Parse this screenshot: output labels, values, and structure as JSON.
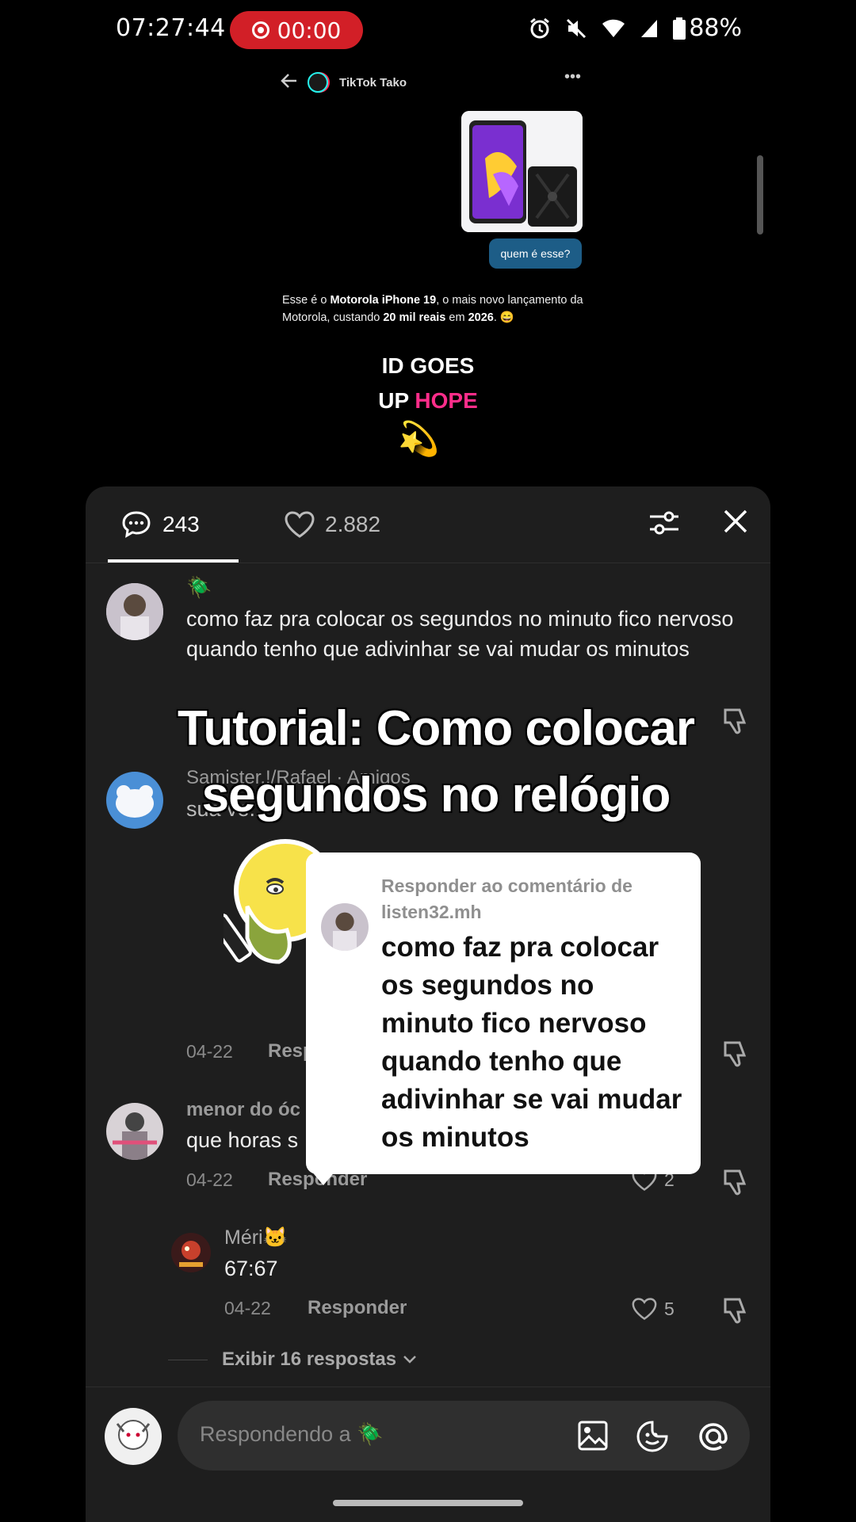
{
  "status_bar": {
    "time": "07:27:44",
    "recording_time": "00:00",
    "battery": "88%"
  },
  "chat": {
    "app_name": "TikTok Tako",
    "sent_message": "quem é esse?",
    "bot_reply_parts": [
      "Esse é o ",
      "Motorola iPhone 19",
      ", o mais novo lançamento da Motorola, custando ",
      "20 mil reais",
      " em ",
      "2026",
      ". 😄"
    ],
    "caption_line1": "ID GOES",
    "caption_line2_a": "UP ",
    "caption_line2_b": "HOPE",
    "caption_emoji": "💫"
  },
  "comments_panel": {
    "comment_count": "243",
    "like_count": "2.882"
  },
  "comments": [
    {
      "badge": "🪲",
      "text": "como faz pra colocar os segundos no minuto fico nervoso quando tenho que adivinhar se vai mudar os minutos"
    },
    {
      "user": "Samister.!/Rafael · Amigos",
      "text_partial": "sua ve..."
    },
    {
      "date": "04-22",
      "reply_label": "Resp"
    },
    {
      "user": "menor do óc",
      "text": "que horas s",
      "date": "04-22",
      "reply_label": "Responder",
      "likes": "2"
    },
    {
      "user": "Méri🐱",
      "text": "67:67",
      "date": "04-22",
      "reply_label": "Responder",
      "likes": "5"
    }
  ],
  "view_replies": "Exibir 16 respostas",
  "overlay": {
    "title_line1": "Tutorial: Como colocar",
    "title_line2": "segundos no relógio"
  },
  "reply_sticker": {
    "reply_to_label": "Responder ao comentário de listen32.mh",
    "body": "como faz pra colocar os segundos no minuto fico nervoso quando tenho que adivinhar se vai mudar os minutos"
  },
  "input": {
    "placeholder": "Respondendo a 🪲"
  },
  "colors": {
    "sheet_bg": "#1e1e1e",
    "rec_red": "#d21f27",
    "hope_pink": "#ff2d8a",
    "sent_bubble": "#1d5d87"
  }
}
